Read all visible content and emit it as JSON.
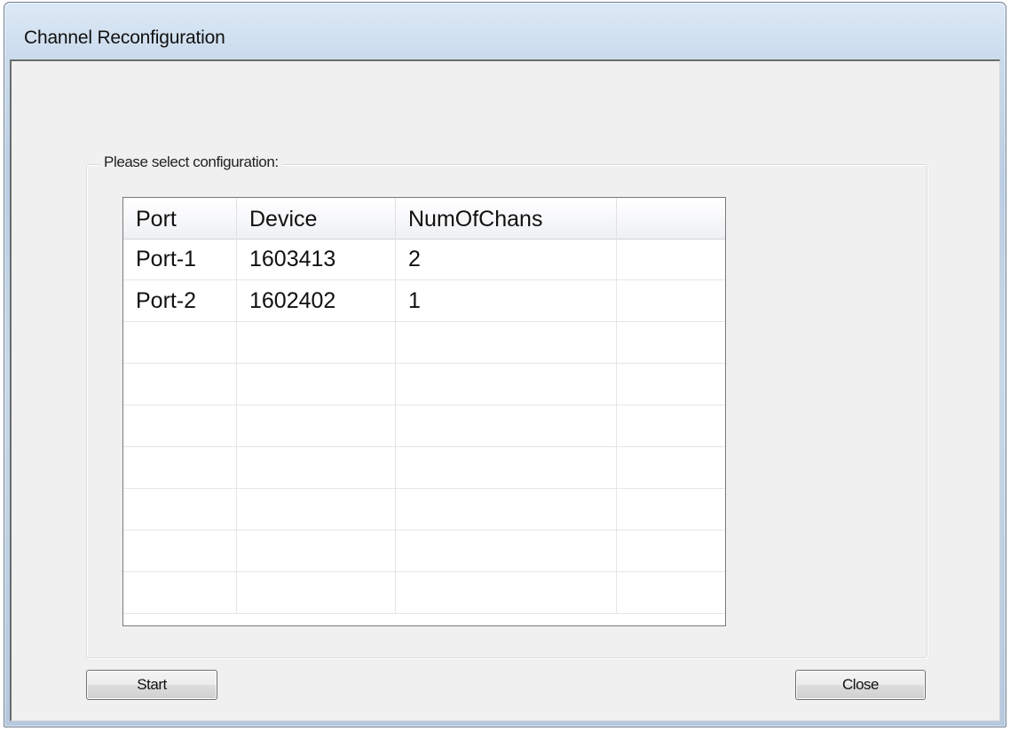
{
  "window": {
    "title": "Channel Reconfiguration"
  },
  "group": {
    "label": "Please select configuration:"
  },
  "table": {
    "columns": [
      "Port",
      "Device",
      "NumOfChans",
      ""
    ],
    "rows": [
      [
        "Port-1",
        "1603413",
        "2",
        ""
      ],
      [
        "Port-2",
        "1602402",
        "1",
        ""
      ]
    ],
    "empty_row_count": 7
  },
  "buttons": {
    "start_label": "Start",
    "close_label": "Close"
  },
  "colors": {
    "frame": "#c9daec",
    "client": "#f0f0f0",
    "grid_background": "#ffffff"
  }
}
